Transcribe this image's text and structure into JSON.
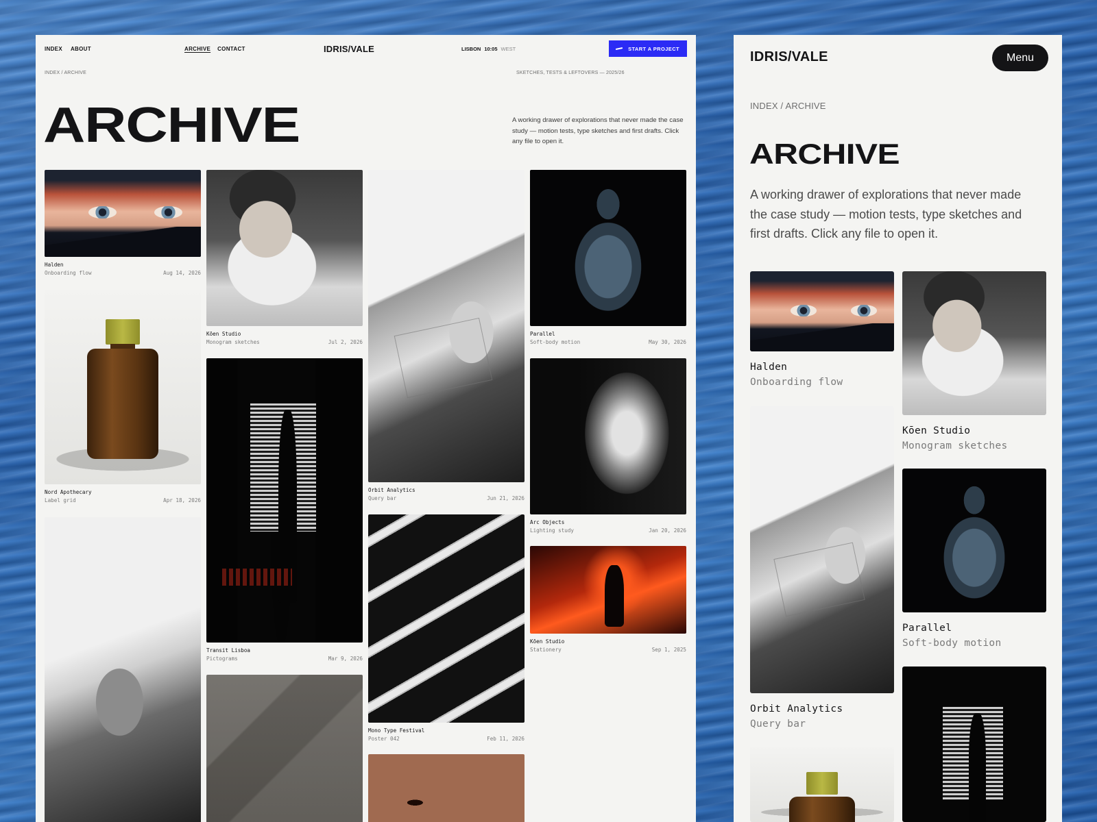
{
  "desktop": {
    "nav_left": [
      "INDEX",
      "ABOUT"
    ],
    "nav_mid": [
      "ARCHIVE",
      "CONTACT"
    ],
    "logo": "IDRIS/VALE",
    "location": {
      "city": "LISBON",
      "time": "10:05",
      "zone": "WEST"
    },
    "cta": "START A PROJECT",
    "breadcrumb": "INDEX / ARCHIVE",
    "subtitle": "SKETCHES, TESTS & LEFTOVERS — 2025/26",
    "title": "ARCHIVE",
    "intro": "A working drawer of explorations that never made the case study — motion tests, type sketches and first drafts. Click any file to open it.",
    "cards": [
      {
        "name": "Halden",
        "desc": "Onboarding flow",
        "date": "Aug 14, 2026"
      },
      {
        "name": "Nord Apothecary",
        "desc": "Label grid",
        "date": "Apr 18, 2026"
      },
      {
        "name": "Kōen Studio",
        "desc": "Monogram sketches",
        "date": "Jul 2, 2026"
      },
      {
        "name": "Transit Lisboa",
        "desc": "Pictograms",
        "date": "Mar 9, 2026"
      },
      {
        "name": "Orbit Analytics",
        "desc": "Query bar",
        "date": "Jun 21, 2026"
      },
      {
        "name": "Mono Type Festival",
        "desc": "Poster 042",
        "date": "Feb 11, 2026"
      },
      {
        "name": "Parallel",
        "desc": "Soft-body motion",
        "date": "May 30, 2026"
      },
      {
        "name": "Arc Objects",
        "desc": "Lighting study",
        "date": "Jan 20, 2026"
      },
      {
        "name": "Kōen Studio",
        "desc": "Stationery",
        "date": "Sep 1, 2025"
      }
    ]
  },
  "mobile": {
    "logo": "IDRIS/VALE",
    "menu": "Menu",
    "breadcrumb": "INDEX / ARCHIVE",
    "title": "ARCHIVE",
    "intro": "A working drawer of explorations that never made the case study — motion tests, type sketches and first drafts. Click any file to open it.",
    "cards": [
      {
        "name": "Halden",
        "desc": "Onboarding flow"
      },
      {
        "name": "Kōen Studio",
        "desc": "Monogram sketches"
      },
      {
        "name": "Orbit Analytics",
        "desc": "Query bar"
      },
      {
        "name": "Parallel",
        "desc": "Soft-body motion"
      }
    ]
  },
  "colors": {
    "accent": "#2b2bf5",
    "panel": "#f4f4f2",
    "ink": "#141416"
  }
}
